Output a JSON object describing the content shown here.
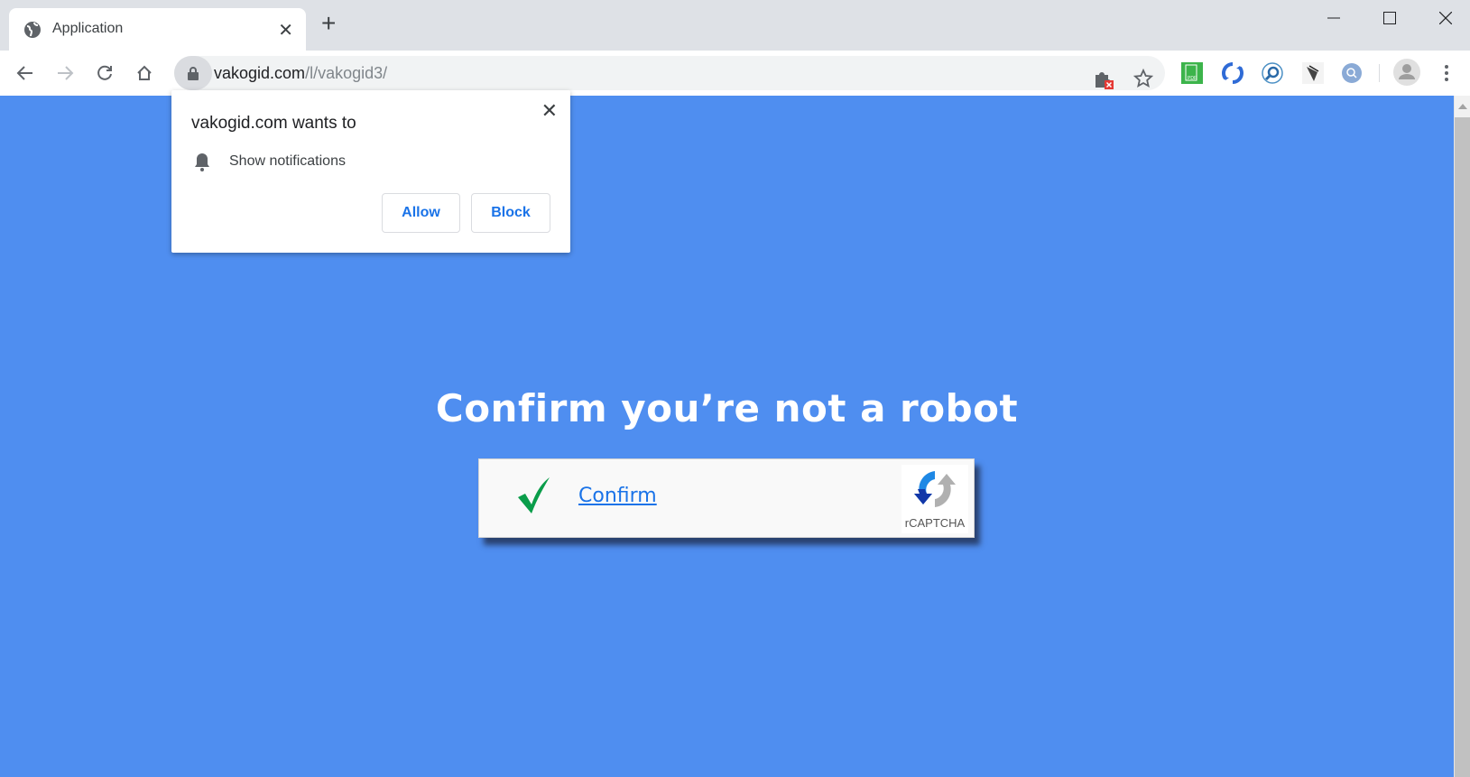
{
  "browser": {
    "tab": {
      "title": "Application",
      "icon": "globe-icon"
    },
    "new_tab_label": "+",
    "window_controls": [
      "minimize",
      "maximize",
      "close"
    ],
    "address_bar": {
      "domain": "vakogid.com",
      "path": "/l/vakogid3/",
      "secure_icon": "lock-icon"
    },
    "extensions": [
      "extension-error-icon",
      "bookmark-star-icon",
      "pdf-extension-icon",
      "sync-extension-icon",
      "search-extension-icon",
      "feather-extension-icon",
      "circle-search-extension-icon"
    ],
    "profile_icon": "avatar-icon",
    "menu_icon": "kebab-menu-icon"
  },
  "permission_popup": {
    "title": "vakogid.com wants to",
    "permission": "Show notifications",
    "allow_label": "Allow",
    "block_label": "Block"
  },
  "page": {
    "heading": "Confirm you’re not a robot",
    "confirm_link": "Confirm",
    "captcha_label": "rCAPTCHA",
    "background_color": "#4f8ef0",
    "check_color": "#0a9d4a",
    "link_color": "#1a73e8"
  }
}
